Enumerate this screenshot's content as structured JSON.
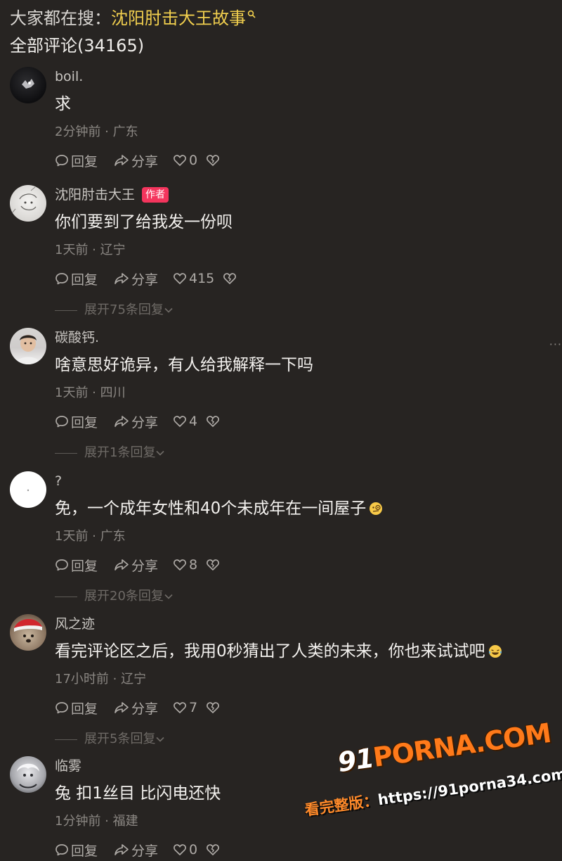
{
  "search": {
    "prefix": "大家都在搜：",
    "term": "沈阳肘击大王故事",
    "icon": "search-icon"
  },
  "comments_header": "全部评论(34165)",
  "labels": {
    "reply": "回复",
    "share": "分享",
    "author_badge": "作者"
  },
  "comments": [
    {
      "username": "boil.",
      "text": "求",
      "meta": "2分钟前 · 广东",
      "likes": "0",
      "avatar": "dark-avatar-with-white-shape"
    },
    {
      "username": "沈阳肘击大王",
      "text": "你们要到了给我发一份呗",
      "meta": "1天前 · 辽宁",
      "likes": "415",
      "expand": "展开75条回复",
      "avatar": "light-sketch-avatar"
    },
    {
      "username": "碳酸钙.",
      "text": "啥意思好诡异，有人给我解释一下吗",
      "meta": "1天前 · 四川",
      "likes": "4",
      "expand": "展开1条回复",
      "avatar": "child-photo-avatar"
    },
    {
      "username": "?",
      "text": "免，一个成年女性和40个未成年在一间屋子",
      "meta": "1天前 · 广东",
      "likes": "8",
      "expand": "展开20条回复",
      "avatar": "white-avatar",
      "emoji": "face-with-monocle-emoji"
    },
    {
      "username": "风之迹",
      "text": "看完评论区之后，我用0秒猜出了人类的未来，你也来试试吧",
      "meta": "17小时前 · 辽宁",
      "likes": "7",
      "expand": "展开5条回复",
      "avatar": "dog-with-santa-hat-avatar",
      "emoji": "laughing-crying-emoji"
    },
    {
      "username": "临雾",
      "text": "兔 扣1丝目 比闪电还快",
      "meta": "1分钟前 · 福建",
      "likes": "0",
      "avatar": "anime-character-avatar"
    }
  ],
  "more_dots": "···",
  "watermark": {
    "logo_num": "91",
    "logo_text": "PORNA.COM",
    "url_prefix": "看完整版：",
    "url": "https://91porna34.com"
  },
  "colors": {
    "background": "#272422",
    "highlight": "#f1cf4e",
    "badge": "#f4355d",
    "watermark_orange": "#ff7a1a"
  }
}
